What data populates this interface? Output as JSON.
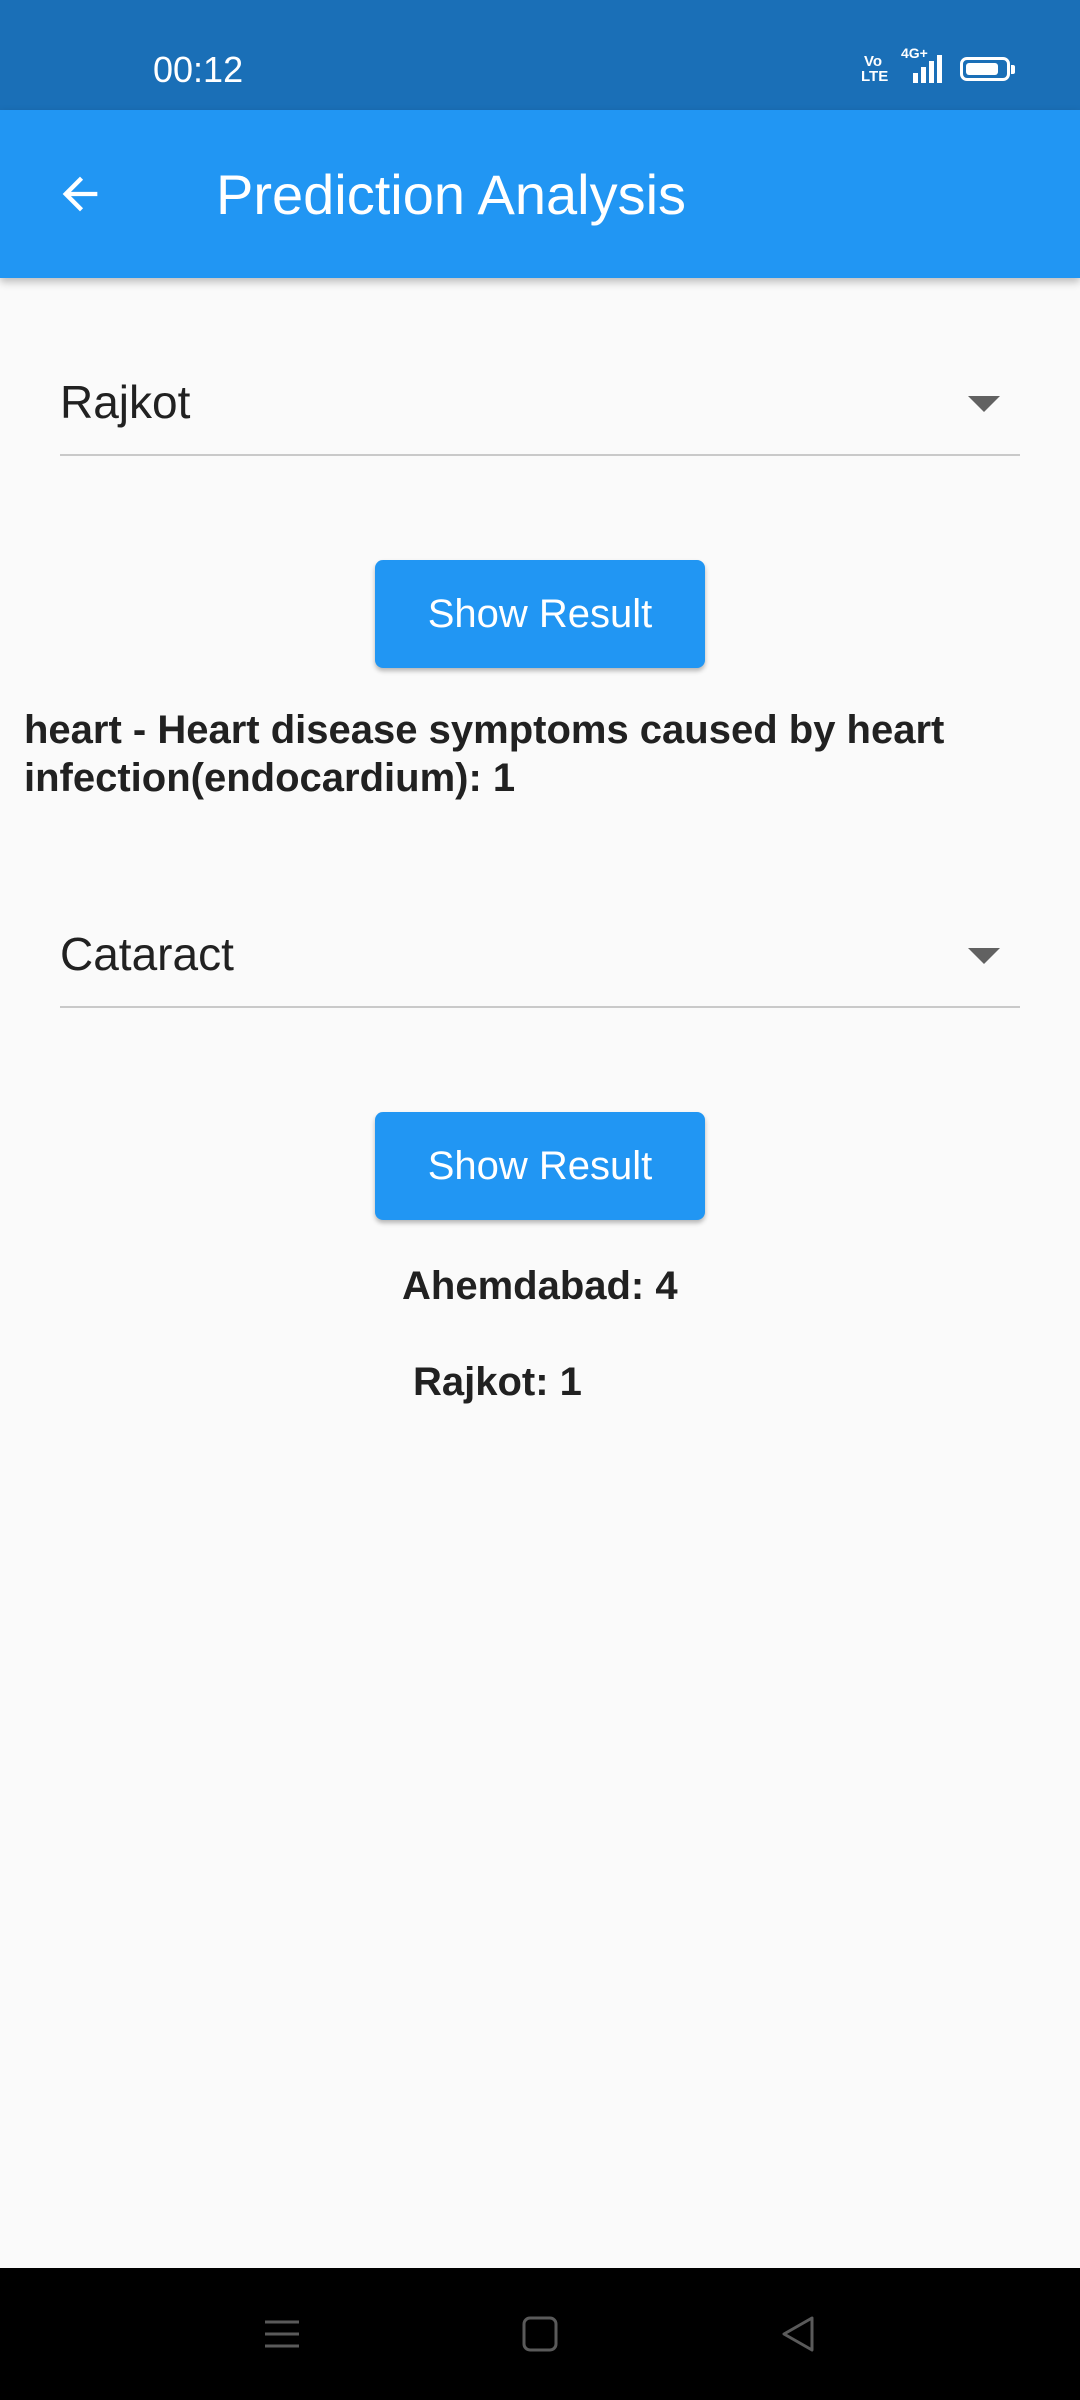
{
  "status_bar": {
    "time": "00:12",
    "volte_top": "Vo",
    "volte_bottom": "LTE",
    "network": "4G+",
    "battery_level": 0.85
  },
  "app_bar": {
    "title": "Prediction Analysis",
    "back_icon": "arrow-back-icon"
  },
  "city_section": {
    "selected_city": "Rajkot",
    "button_label": "Show Result",
    "result_text": "heart - Heart disease symptoms caused by heart infection(endocardium): 1"
  },
  "disease_section": {
    "selected_disease": "Cataract",
    "button_label": "Show Result",
    "results": [
      {
        "text": "Ahemdabad: 4"
      },
      {
        "text": "Rajkot: 1"
      }
    ]
  },
  "nav_bar": {
    "icons": [
      "menu-icon",
      "home-icon",
      "back-triangle-icon"
    ]
  },
  "colors": {
    "status_bar": "#1a6fb7",
    "app_bar": "#2196f3",
    "button": "#2196f3",
    "background": "#fafafa"
  }
}
